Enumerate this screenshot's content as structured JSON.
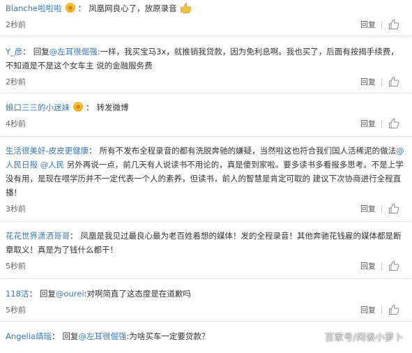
{
  "comments": [
    {
      "user": "Blanche啦啦啦",
      "has_badge": true,
      "segments": [
        {
          "type": "text",
          "value": "凤凰网良心了，放原录音"
        }
      ],
      "emoji": "thumbs-up",
      "time": "2秒前"
    },
    {
      "user": "Y_彦",
      "has_badge": false,
      "segments": [
        {
          "type": "text",
          "value": "回复"
        },
        {
          "type": "mention",
          "value": "@左耳很倔强"
        },
        {
          "type": "text",
          "value": ":一样，我买宝马3x，就推销我贷款，因为免利息啊。我也买了，后面有按揭手续费，不知道是不是这个女车主 说的金融服务费"
        }
      ],
      "time": "2秒前"
    },
    {
      "user": "娘口三三的小迷妹",
      "has_badge": true,
      "segments": [
        {
          "type": "text",
          "value": "转发微博"
        }
      ],
      "time": "4秒前"
    },
    {
      "user": "生活很美好-皮皮更健康",
      "has_badge": false,
      "segments": [
        {
          "type": "text",
          "value": "所有不发布全程录音的都有洗脱奔驰的嫌疑，当然啦这也符合我们国人活稀泥的做法"
        },
        {
          "type": "mention",
          "value": "@人民日报"
        },
        {
          "type": "text",
          "value": " "
        },
        {
          "type": "mention",
          "value": "@人民"
        },
        {
          "type": "text",
          "value": " 另外再说一点，前几天有人说读书不用论的，真是傻到家啦。要多读书多看报多思考。不是上学没有用，是现在喂学历并不一定代表一个人的素养，但读书，前人的智慧是肯定可取的 建议下次协商进行全程直播！"
        }
      ],
      "time": "3秒前"
    },
    {
      "user": "花花世界潇洒哥哥",
      "has_badge": false,
      "segments": [
        {
          "type": "text",
          "value": "凤凰是我见过最良心最为老百姓着想的媒体！发的全程录音！其他奔驰花钱雇的媒体都是断章取义！真是为了钱什么都干！"
        }
      ],
      "time": "5秒前"
    },
    {
      "user": "118洁",
      "has_badge": false,
      "segments": [
        {
          "type": "text",
          "value": "回复"
        },
        {
          "type": "mention",
          "value": "@ourei"
        },
        {
          "type": "text",
          "value": ":对啊简直了这态度是在道歉吗"
        }
      ],
      "time": "5秒前"
    },
    {
      "user": "Angelia靖瑶",
      "has_badge": false,
      "segments": [
        {
          "type": "text",
          "value": "回复"
        },
        {
          "type": "mention",
          "value": "@左耳很倔强"
        },
        {
          "type": "text",
          "value": ":为啥买车一定要贷款？"
        }
      ],
      "time": ""
    }
  ],
  "reply_label": "回复",
  "watermark": "百家号/闲谈小萝卜",
  "colors": {
    "link": "#3a78b6",
    "text": "#333333",
    "divider": "#e6e6e6"
  }
}
